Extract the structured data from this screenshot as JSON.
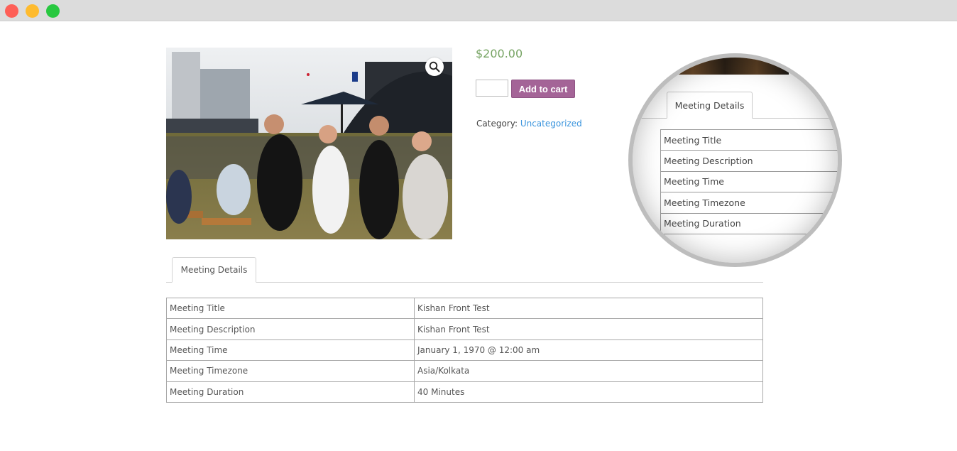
{
  "window": {
    "controls": [
      "close",
      "minimize",
      "maximize"
    ]
  },
  "product": {
    "price": "$200.00",
    "quantity_value": "",
    "add_to_cart_label": "Add to cart",
    "category_label": "Category:",
    "category_link": "Uncategorized"
  },
  "tabs": [
    {
      "label": "Meeting Details"
    }
  ],
  "details": {
    "rows": [
      {
        "key": "Meeting Title",
        "value": "Kishan Front Test"
      },
      {
        "key": "Meeting Description",
        "value": "Kishan Front Test"
      },
      {
        "key": "Meeting Time",
        "value": "January 1, 1970 @ 12:00 am"
      },
      {
        "key": "Meeting Timezone",
        "value": "Asia/Kolkata"
      },
      {
        "key": "Meeting Duration",
        "value": "40 Minutes"
      }
    ]
  },
  "magnifier": {
    "tab_label": "Meeting Details",
    "rows": [
      "Meeting Title",
      "Meeting Description",
      "Meeting Time",
      "Meeting Timezone",
      "Meeting Duration"
    ]
  },
  "icons": {
    "zoom": "magnifier-zoom-icon"
  },
  "colors": {
    "price": "#77a464",
    "button": "#a46497",
    "link": "#3a94dd"
  }
}
